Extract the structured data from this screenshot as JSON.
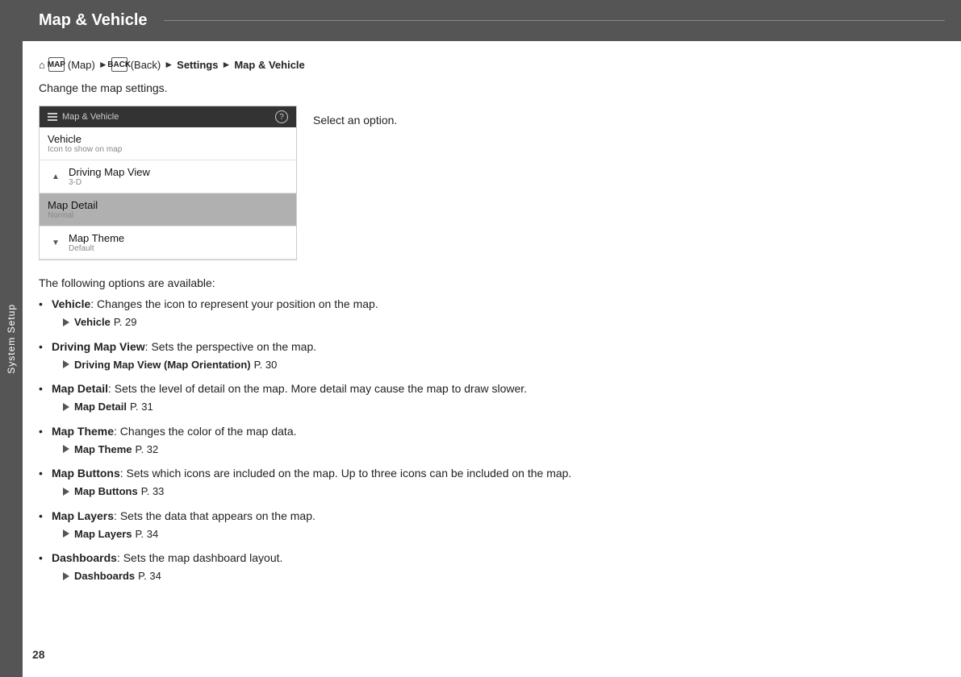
{
  "sidebar": {
    "label": "System Setup"
  },
  "header": {
    "title": "Map & Vehicle"
  },
  "breadcrumb": {
    "home_icon": "⌂",
    "map_icon": "MAP",
    "back_icon": "BACK",
    "map_label": "(Map)",
    "back_label": "(Back)",
    "settings": "Settings",
    "current": "Map & Vehicle"
  },
  "intro": "Change the map settings.",
  "screen": {
    "title": "Map & Vehicle",
    "menu_items": [
      {
        "name": "Vehicle",
        "sub": "Icon to show on map",
        "highlighted": false,
        "scroll": "none"
      },
      {
        "name": "Driving Map View",
        "sub": "3-D",
        "highlighted": false,
        "scroll": "up"
      },
      {
        "name": "Map Detail",
        "sub": "Normal",
        "highlighted": true,
        "scroll": "none"
      },
      {
        "name": "Map Theme",
        "sub": "Default",
        "highlighted": false,
        "scroll": "down"
      }
    ]
  },
  "select_option": "Select an option.",
  "options_intro": "The following options are available:",
  "options": [
    {
      "name": "Vehicle",
      "description": ": Changes the icon to represent your position on the map.",
      "ref_label": "Vehicle",
      "ref_page": "P. 29"
    },
    {
      "name": "Driving Map View",
      "description": ": Sets the perspective on the map.",
      "ref_label": "Driving Map View (Map Orientation)",
      "ref_page": "P. 30"
    },
    {
      "name": "Map Detail",
      "description": ": Sets the level of detail on the map. More detail may cause the map to draw slower.",
      "ref_label": "Map Detail",
      "ref_page": "P. 31"
    },
    {
      "name": "Map Theme",
      "description": ": Changes the color of the map data.",
      "ref_label": "Map Theme",
      "ref_page": "P. 32"
    },
    {
      "name": "Map Buttons",
      "description": ": Sets which icons are included on the map. Up to three icons can be included on the map.",
      "ref_label": "Map Buttons",
      "ref_page": "P. 33"
    },
    {
      "name": "Map Layers",
      "description": ": Sets the data that appears on the map.",
      "ref_label": "Map Layers",
      "ref_page": "P. 34"
    },
    {
      "name": "Dashboards",
      "description": ": Sets the map dashboard layout.",
      "ref_label": "Dashboards",
      "ref_page": "P. 34"
    }
  ],
  "page_number": "28"
}
